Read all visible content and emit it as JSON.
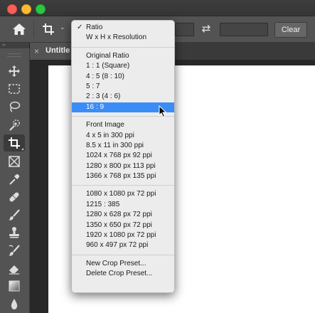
{
  "toolbar": {
    "home_icon": "home-icon",
    "crop_icon": "crop-icon",
    "swap_icon": "swap-icon",
    "clear_label": "Clear"
  },
  "document": {
    "tab_title": "Untitle",
    "close_glyph": "×"
  },
  "tools_header": "››",
  "tools": [
    {
      "name": "move-tool",
      "icon": "move-icon",
      "active": false
    },
    {
      "name": "rectangular-marquee-tool",
      "icon": "marquee-icon",
      "active": false
    },
    {
      "name": "lasso-tool",
      "icon": "lasso-icon",
      "active": false
    },
    {
      "name": "quick-selection-tool",
      "icon": "quick-selection-icon",
      "active": false
    },
    {
      "name": "crop-tool",
      "icon": "crop-icon",
      "active": true
    },
    {
      "name": "frame-tool",
      "icon": "frame-icon",
      "active": false
    },
    {
      "name": "eyedropper-tool",
      "icon": "eyedropper-icon",
      "active": false
    },
    {
      "name": "healing-brush-tool",
      "icon": "bandage-icon",
      "active": false
    },
    {
      "name": "brush-tool",
      "icon": "brush-icon",
      "active": false
    },
    {
      "name": "clone-stamp-tool",
      "icon": "stamp-icon",
      "active": false
    },
    {
      "name": "history-brush-tool",
      "icon": "history-brush-icon",
      "active": false
    },
    {
      "name": "eraser-tool",
      "icon": "eraser-icon",
      "active": false
    },
    {
      "name": "gradient-tool",
      "icon": "gradient-icon",
      "active": false
    },
    {
      "name": "blur-tool",
      "icon": "drop-icon",
      "active": false
    }
  ],
  "menu": {
    "check_glyph": "✓",
    "group1": [
      "Ratio",
      "W x H x Resolution"
    ],
    "group2": [
      "Original Ratio",
      "1 : 1 (Square)",
      "4 : 5 (8 : 10)",
      "5 : 7",
      "2 : 3 (4 : 6)",
      "16 : 9"
    ],
    "group3": [
      "Front Image",
      "4 x 5 in 300 ppi",
      "8.5 x 11 in 300 ppi",
      "1024 x 768 px 92 ppi",
      "1280 x 800 px 113 ppi",
      "1366 x 768 px 135 ppi"
    ],
    "group4": [
      "1080 x 1080 px 72 ppi",
      "1215 : 385",
      "1280 x 628 px 72 ppi",
      "1350 x 650 px 72 ppi",
      "1920 x 1080 px 72 ppi",
      "960 x 497 px 72 ppi"
    ],
    "group5": [
      "New Crop Preset...",
      "Delete Crop Preset..."
    ],
    "checked_item": "Ratio",
    "highlighted_item": "16 : 9"
  },
  "colors": {
    "menu_highlight": "#3a8df6",
    "clear_button": "#666666",
    "panel": "#535353"
  }
}
